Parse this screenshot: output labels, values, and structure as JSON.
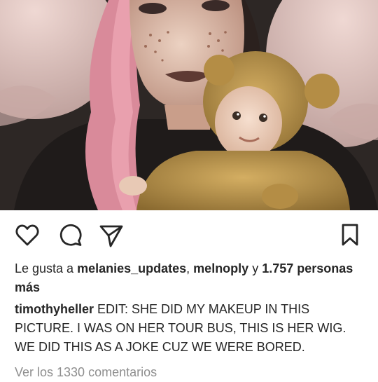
{
  "post": {
    "likes": {
      "prefix": "Le gusta a ",
      "user1": "melanies_updates",
      "separator": ", ",
      "user2": "melnoply",
      "and": " y ",
      "count_text": "1.757 personas más"
    },
    "caption": {
      "username": "timothyheller",
      "text": "EDIT: SHE DID MY MAKEUP IN THIS PICTURE. I WAS ON HER TOUR BUS, THIS IS HER WIG. WE DID THIS AS A JOKE CUZ WE WERE BORED."
    },
    "view_comments": "Ver los 1330 comentarios"
  },
  "icons": {
    "like": "heart-outline-icon",
    "comment": "comment-bubble-icon",
    "share": "paper-plane-icon",
    "save": "bookmark-icon"
  },
  "colors": {
    "text": "#262626",
    "muted": "#8e8e8e",
    "icon": "#262626"
  }
}
